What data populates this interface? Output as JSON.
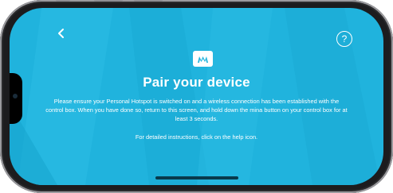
{
  "screen": {
    "title": "Pair your device",
    "instructions": "Please ensure your Personal Hotspot is switched on and a wireless connection has been established with the control box. When you have done so, return to this screen, and hold down the mina button on your control box for at least 3 seconds.",
    "help_hint": "For detailed instructions, click on the help icon.",
    "help_label": "?",
    "back_icon": "chevron-left-icon",
    "logo_icon": "mina-logo-icon"
  },
  "colors": {
    "background": "#20b3dd",
    "text": "#ffffff",
    "logo_mark": "#20b3dd"
  }
}
